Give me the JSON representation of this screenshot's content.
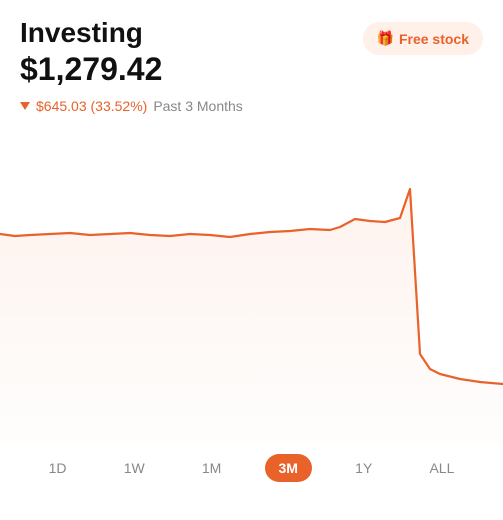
{
  "header": {
    "title": "Investing",
    "amount": "$1,279.42",
    "free_stock_label": "Free stock",
    "gift_icon": "🎁"
  },
  "change": {
    "arrow": "▼",
    "value": "$645.03 (33.52%)",
    "period": "Past 3 Months"
  },
  "tabs": [
    {
      "id": "1d",
      "label": "1D",
      "active": false
    },
    {
      "id": "1w",
      "label": "1W",
      "active": false
    },
    {
      "id": "1m",
      "label": "1M",
      "active": false
    },
    {
      "id": "3m",
      "label": "3M",
      "active": true
    },
    {
      "id": "1y",
      "label": "1Y",
      "active": false
    },
    {
      "id": "all",
      "label": "ALL",
      "active": false
    }
  ],
  "colors": {
    "accent": "#e8622a",
    "active_tab_bg": "#e8622a",
    "free_stock_bg": "#fff0ea"
  }
}
